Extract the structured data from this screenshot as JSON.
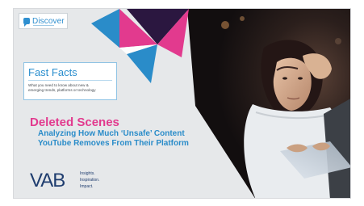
{
  "discover": {
    "label": "Discover"
  },
  "fast_facts": {
    "title": "Fast Facts",
    "subtitle_line1": "What you need to know about new &",
    "subtitle_line2": "emerging trends, platforms or technology"
  },
  "headline": "Deleted Scenes",
  "subheadline_line1": "Analyzing How Much ‘Unsafe’ Content",
  "subheadline_line2": "YouTube Removes From Their Platform",
  "logo": {
    "letters": "VAB",
    "tagline": [
      "Insights.",
      "Inspiration.",
      "Impact."
    ]
  },
  "colors": {
    "pink": "#e23a8e",
    "blue": "#2a8cc9",
    "navy": "#1f3d6f",
    "dark_purple": "#2b1740"
  }
}
